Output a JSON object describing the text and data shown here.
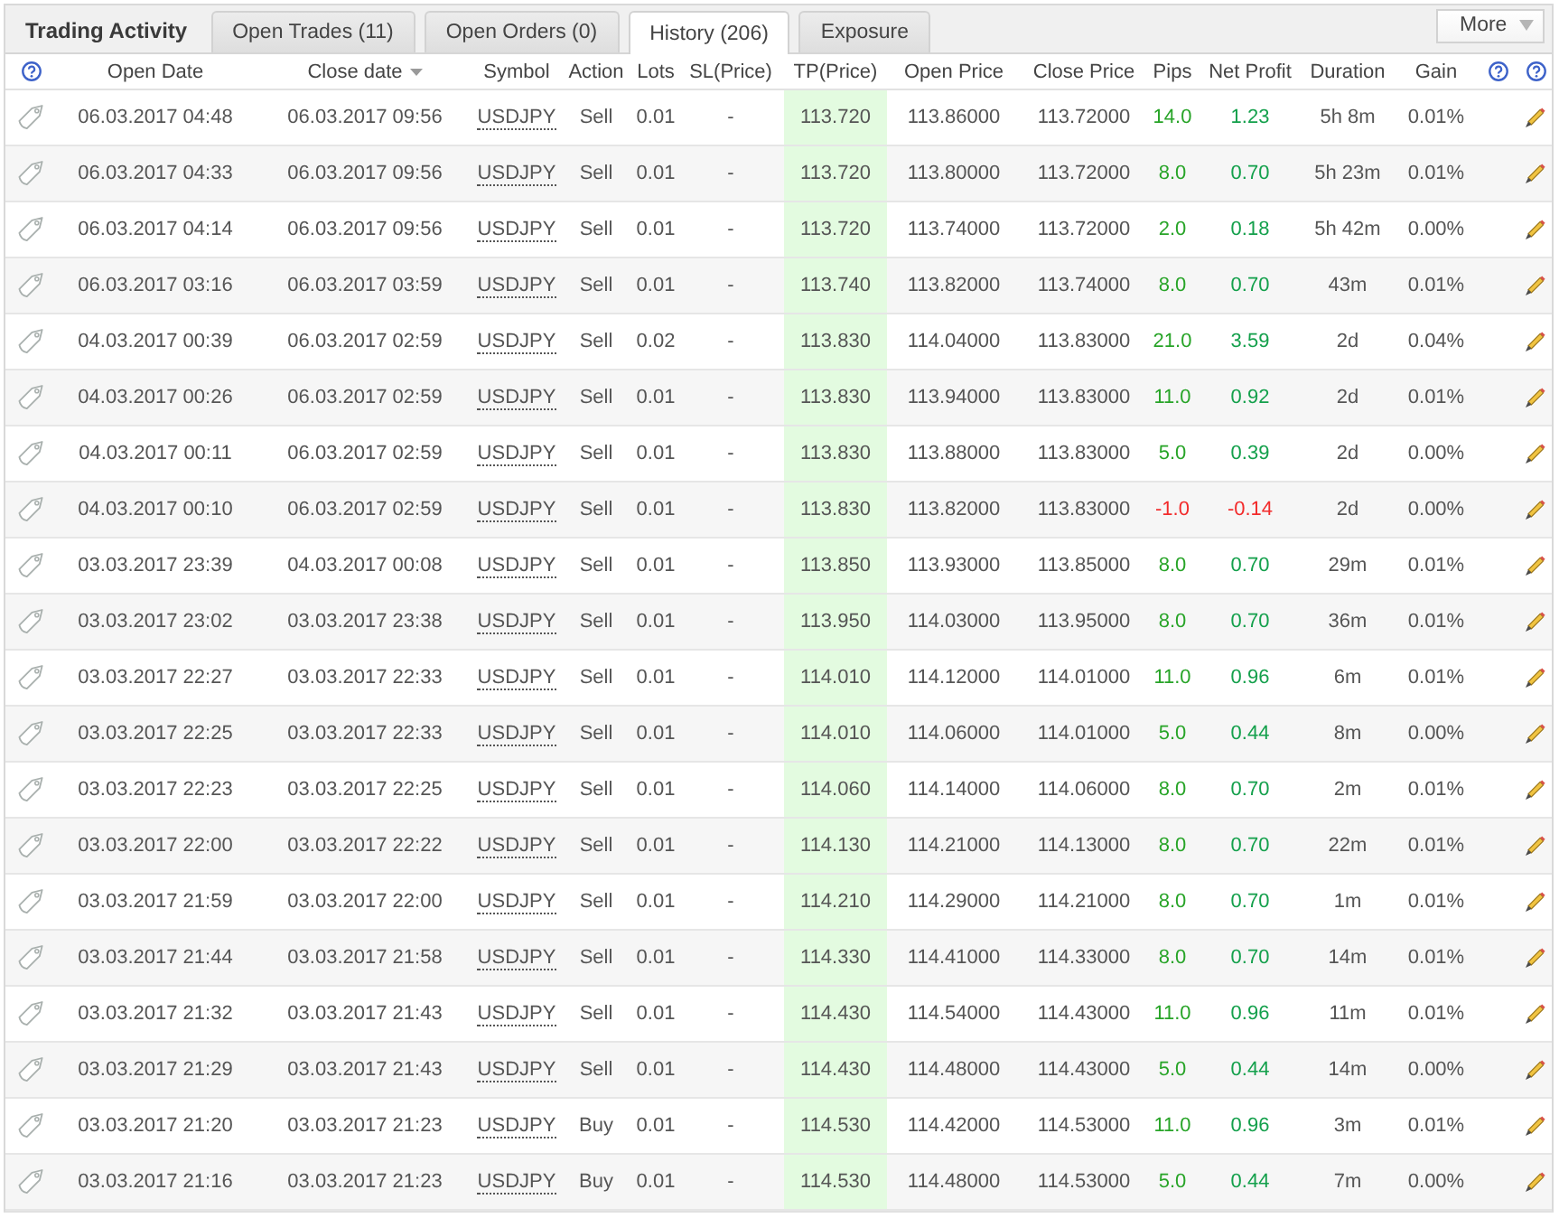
{
  "title": "Trading Activity",
  "tabs": [
    {
      "label": "Open Trades (11)",
      "selected": false
    },
    {
      "label": "Open Orders (0)",
      "selected": false
    },
    {
      "label": "History (206)",
      "selected": true
    },
    {
      "label": "Exposure",
      "selected": false
    }
  ],
  "more_button": {
    "label": "More"
  },
  "table": {
    "columns": [
      {
        "label": "Open Date",
        "sorted": false
      },
      {
        "label": "Close date",
        "sorted": true
      },
      {
        "label": "Symbol",
        "sorted": false
      },
      {
        "label": "Action",
        "sorted": false
      },
      {
        "label": "Lots",
        "sorted": false
      },
      {
        "label": "SL(Price)",
        "sorted": false
      },
      {
        "label": "TP(Price)",
        "sorted": false
      },
      {
        "label": "Open Price",
        "sorted": false
      },
      {
        "label": "Close Price",
        "sorted": false
      },
      {
        "label": "Pips",
        "sorted": false
      },
      {
        "label": "Net Profit",
        "sorted": false
      },
      {
        "label": "Duration",
        "sorted": false
      },
      {
        "label": "Gain",
        "sorted": false
      }
    ],
    "rows": [
      {
        "open_date": "06.03.2017 04:48",
        "close_date": "06.03.2017 09:56",
        "symbol": "USDJPY",
        "action": "Sell",
        "lots": "0.01",
        "sl_price": "-",
        "tp_price": "113.720",
        "open_price": "113.86000",
        "close_price": "113.72000",
        "pips": "14.0",
        "net_profit": "1.23",
        "duration": "5h 8m",
        "gain": "0.01%",
        "loss": false
      },
      {
        "open_date": "06.03.2017 04:33",
        "close_date": "06.03.2017 09:56",
        "symbol": "USDJPY",
        "action": "Sell",
        "lots": "0.01",
        "sl_price": "-",
        "tp_price": "113.720",
        "open_price": "113.80000",
        "close_price": "113.72000",
        "pips": "8.0",
        "net_profit": "0.70",
        "duration": "5h 23m",
        "gain": "0.01%",
        "loss": false
      },
      {
        "open_date": "06.03.2017 04:14",
        "close_date": "06.03.2017 09:56",
        "symbol": "USDJPY",
        "action": "Sell",
        "lots": "0.01",
        "sl_price": "-",
        "tp_price": "113.720",
        "open_price": "113.74000",
        "close_price": "113.72000",
        "pips": "2.0",
        "net_profit": "0.18",
        "duration": "5h 42m",
        "gain": "0.00%",
        "loss": false
      },
      {
        "open_date": "06.03.2017 03:16",
        "close_date": "06.03.2017 03:59",
        "symbol": "USDJPY",
        "action": "Sell",
        "lots": "0.01",
        "sl_price": "-",
        "tp_price": "113.740",
        "open_price": "113.82000",
        "close_price": "113.74000",
        "pips": "8.0",
        "net_profit": "0.70",
        "duration": "43m",
        "gain": "0.01%",
        "loss": false
      },
      {
        "open_date": "04.03.2017 00:39",
        "close_date": "06.03.2017 02:59",
        "symbol": "USDJPY",
        "action": "Sell",
        "lots": "0.02",
        "sl_price": "-",
        "tp_price": "113.830",
        "open_price": "114.04000",
        "close_price": "113.83000",
        "pips": "21.0",
        "net_profit": "3.59",
        "duration": "2d",
        "gain": "0.04%",
        "loss": false
      },
      {
        "open_date": "04.03.2017 00:26",
        "close_date": "06.03.2017 02:59",
        "symbol": "USDJPY",
        "action": "Sell",
        "lots": "0.01",
        "sl_price": "-",
        "tp_price": "113.830",
        "open_price": "113.94000",
        "close_price": "113.83000",
        "pips": "11.0",
        "net_profit": "0.92",
        "duration": "2d",
        "gain": "0.01%",
        "loss": false
      },
      {
        "open_date": "04.03.2017 00:11",
        "close_date": "06.03.2017 02:59",
        "symbol": "USDJPY",
        "action": "Sell",
        "lots": "0.01",
        "sl_price": "-",
        "tp_price": "113.830",
        "open_price": "113.88000",
        "close_price": "113.83000",
        "pips": "5.0",
        "net_profit": "0.39",
        "duration": "2d",
        "gain": "0.00%",
        "loss": false
      },
      {
        "open_date": "04.03.2017 00:10",
        "close_date": "06.03.2017 02:59",
        "symbol": "USDJPY",
        "action": "Sell",
        "lots": "0.01",
        "sl_price": "-",
        "tp_price": "113.830",
        "open_price": "113.82000",
        "close_price": "113.83000",
        "pips": "-1.0",
        "net_profit": "-0.14",
        "duration": "2d",
        "gain": "0.00%",
        "loss": true
      },
      {
        "open_date": "03.03.2017 23:39",
        "close_date": "04.03.2017 00:08",
        "symbol": "USDJPY",
        "action": "Sell",
        "lots": "0.01",
        "sl_price": "-",
        "tp_price": "113.850",
        "open_price": "113.93000",
        "close_price": "113.85000",
        "pips": "8.0",
        "net_profit": "0.70",
        "duration": "29m",
        "gain": "0.01%",
        "loss": false
      },
      {
        "open_date": "03.03.2017 23:02",
        "close_date": "03.03.2017 23:38",
        "symbol": "USDJPY",
        "action": "Sell",
        "lots": "0.01",
        "sl_price": "-",
        "tp_price": "113.950",
        "open_price": "114.03000",
        "close_price": "113.95000",
        "pips": "8.0",
        "net_profit": "0.70",
        "duration": "36m",
        "gain": "0.01%",
        "loss": false
      },
      {
        "open_date": "03.03.2017 22:27",
        "close_date": "03.03.2017 22:33",
        "symbol": "USDJPY",
        "action": "Sell",
        "lots": "0.01",
        "sl_price": "-",
        "tp_price": "114.010",
        "open_price": "114.12000",
        "close_price": "114.01000",
        "pips": "11.0",
        "net_profit": "0.96",
        "duration": "6m",
        "gain": "0.01%",
        "loss": false
      },
      {
        "open_date": "03.03.2017 22:25",
        "close_date": "03.03.2017 22:33",
        "symbol": "USDJPY",
        "action": "Sell",
        "lots": "0.01",
        "sl_price": "-",
        "tp_price": "114.010",
        "open_price": "114.06000",
        "close_price": "114.01000",
        "pips": "5.0",
        "net_profit": "0.44",
        "duration": "8m",
        "gain": "0.00%",
        "loss": false
      },
      {
        "open_date": "03.03.2017 22:23",
        "close_date": "03.03.2017 22:25",
        "symbol": "USDJPY",
        "action": "Sell",
        "lots": "0.01",
        "sl_price": "-",
        "tp_price": "114.060",
        "open_price": "114.14000",
        "close_price": "114.06000",
        "pips": "8.0",
        "net_profit": "0.70",
        "duration": "2m",
        "gain": "0.01%",
        "loss": false
      },
      {
        "open_date": "03.03.2017 22:00",
        "close_date": "03.03.2017 22:22",
        "symbol": "USDJPY",
        "action": "Sell",
        "lots": "0.01",
        "sl_price": "-",
        "tp_price": "114.130",
        "open_price": "114.21000",
        "close_price": "114.13000",
        "pips": "8.0",
        "net_profit": "0.70",
        "duration": "22m",
        "gain": "0.01%",
        "loss": false
      },
      {
        "open_date": "03.03.2017 21:59",
        "close_date": "03.03.2017 22:00",
        "symbol": "USDJPY",
        "action": "Sell",
        "lots": "0.01",
        "sl_price": "-",
        "tp_price": "114.210",
        "open_price": "114.29000",
        "close_price": "114.21000",
        "pips": "8.0",
        "net_profit": "0.70",
        "duration": "1m",
        "gain": "0.01%",
        "loss": false
      },
      {
        "open_date": "03.03.2017 21:44",
        "close_date": "03.03.2017 21:58",
        "symbol": "USDJPY",
        "action": "Sell",
        "lots": "0.01",
        "sl_price": "-",
        "tp_price": "114.330",
        "open_price": "114.41000",
        "close_price": "114.33000",
        "pips": "8.0",
        "net_profit": "0.70",
        "duration": "14m",
        "gain": "0.01%",
        "loss": false
      },
      {
        "open_date": "03.03.2017 21:32",
        "close_date": "03.03.2017 21:43",
        "symbol": "USDJPY",
        "action": "Sell",
        "lots": "0.01",
        "sl_price": "-",
        "tp_price": "114.430",
        "open_price": "114.54000",
        "close_price": "114.43000",
        "pips": "11.0",
        "net_profit": "0.96",
        "duration": "11m",
        "gain": "0.01%",
        "loss": false
      },
      {
        "open_date": "03.03.2017 21:29",
        "close_date": "03.03.2017 21:43",
        "symbol": "USDJPY",
        "action": "Sell",
        "lots": "0.01",
        "sl_price": "-",
        "tp_price": "114.430",
        "open_price": "114.48000",
        "close_price": "114.43000",
        "pips": "5.0",
        "net_profit": "0.44",
        "duration": "14m",
        "gain": "0.00%",
        "loss": false
      },
      {
        "open_date": "03.03.2017 21:20",
        "close_date": "03.03.2017 21:23",
        "symbol": "USDJPY",
        "action": "Buy",
        "lots": "0.01",
        "sl_price": "-",
        "tp_price": "114.530",
        "open_price": "114.42000",
        "close_price": "114.53000",
        "pips": "11.0",
        "net_profit": "0.96",
        "duration": "3m",
        "gain": "0.01%",
        "loss": false
      },
      {
        "open_date": "03.03.2017 21:16",
        "close_date": "03.03.2017 21:23",
        "symbol": "USDJPY",
        "action": "Buy",
        "lots": "0.01",
        "sl_price": "-",
        "tp_price": "114.530",
        "open_price": "114.48000",
        "close_price": "114.53000",
        "pips": "5.0",
        "net_profit": "0.44",
        "duration": "7m",
        "gain": "0.00%",
        "loss": false
      }
    ]
  }
}
